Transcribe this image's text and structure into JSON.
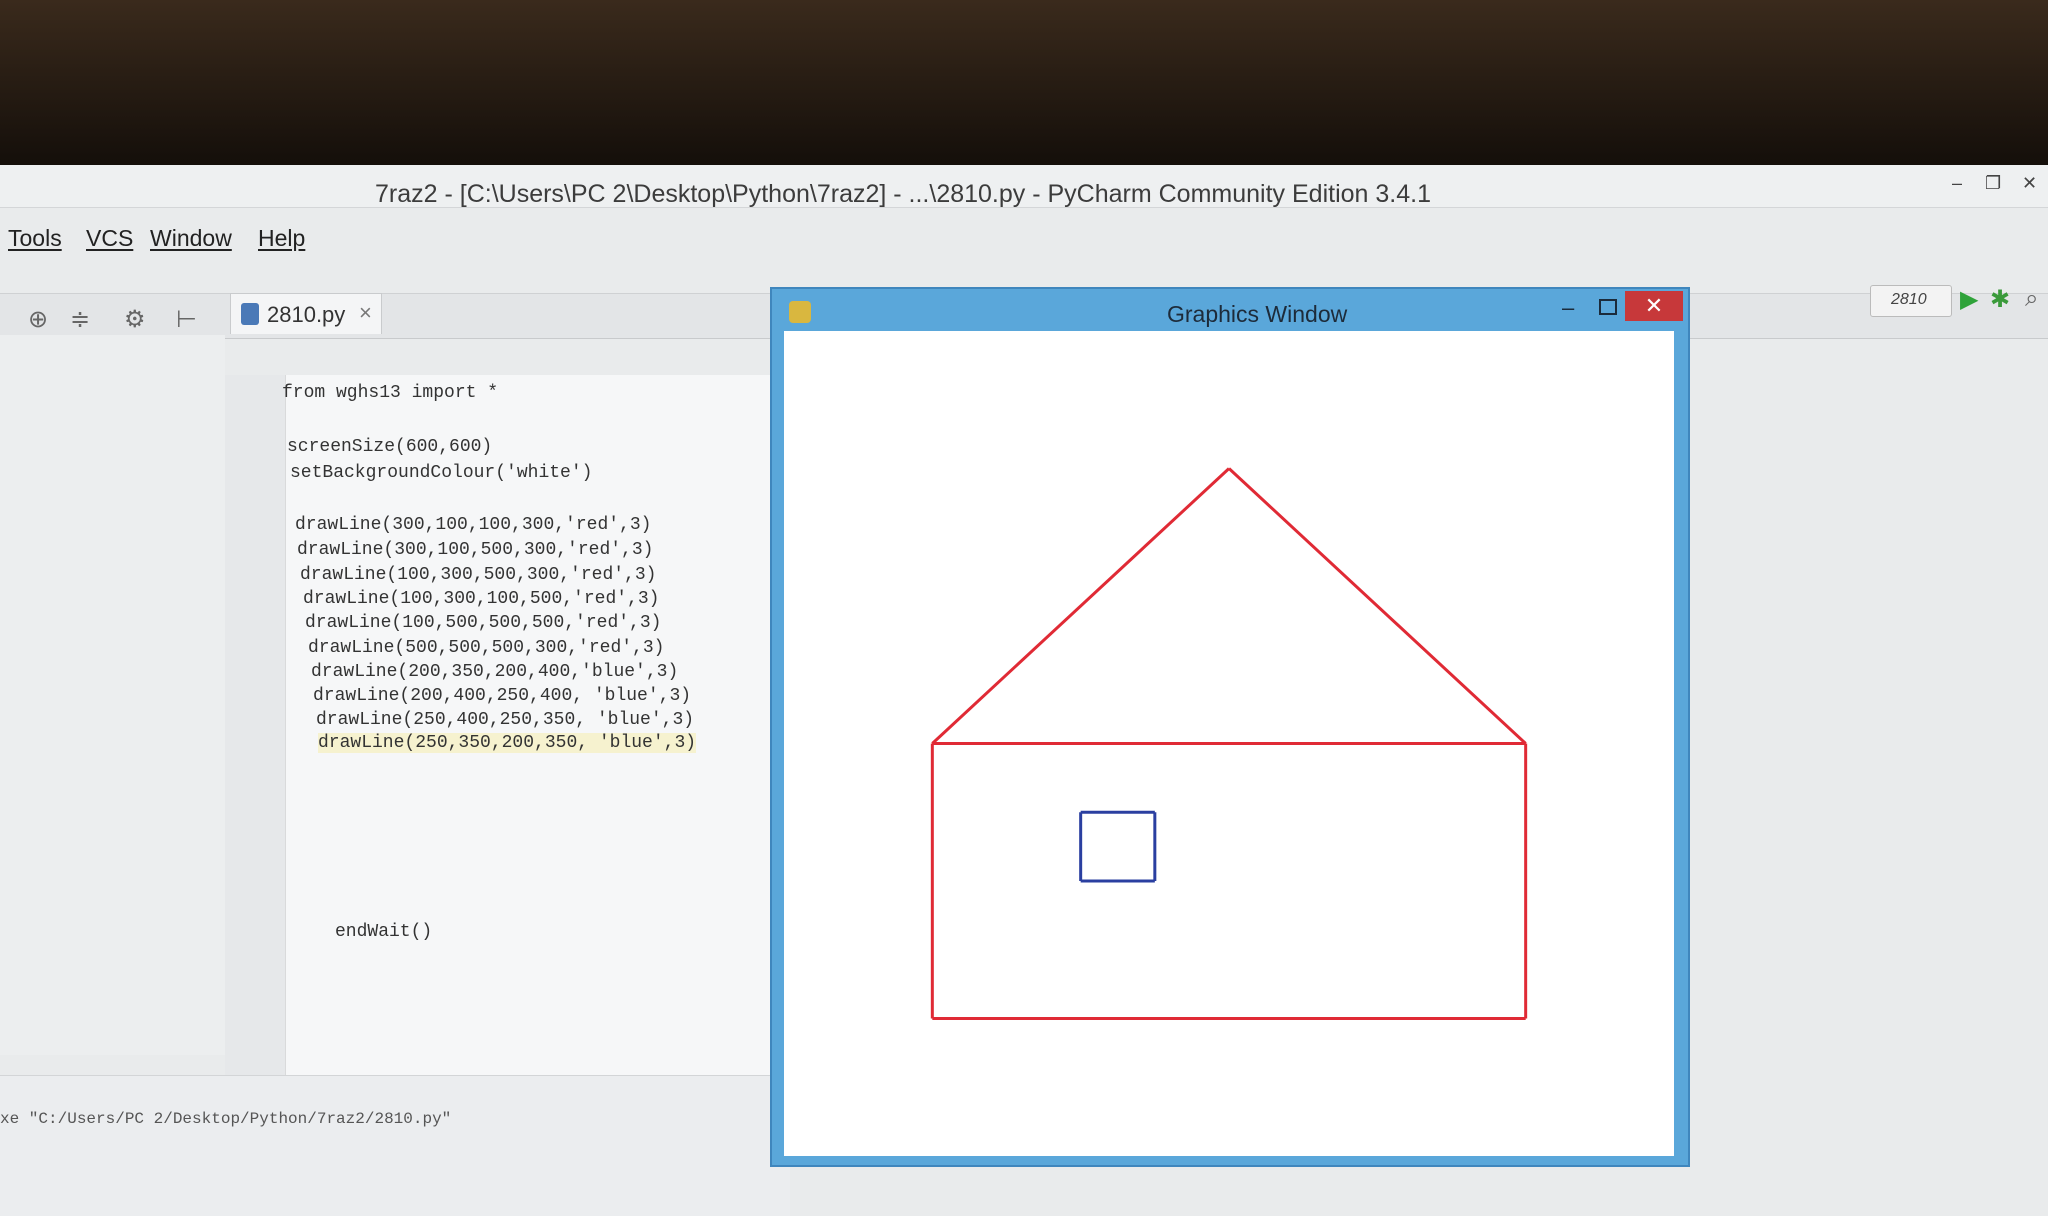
{
  "window": {
    "title": "7raz2 - [C:\\Users\\PC 2\\Desktop\\Python\\7raz2] - ...\\2810.py - PyCharm Community Edition 3.4.1",
    "minimize": "–",
    "maximize": "❐",
    "close": "✕"
  },
  "menu": [
    "Tools",
    "VCS",
    "Window",
    "Help"
  ],
  "tab": {
    "label": "2810.py",
    "close": "×"
  },
  "run_config": {
    "label": "2810"
  },
  "code": [
    "from wghs13 import *",
    "",
    "screenSize(600,600)",
    "setBackgroundColour('white')",
    "",
    "drawLine(300,100,100,300,'red',3)",
    "drawLine(300,100,500,300,'red',3)",
    "drawLine(100,300,500,300,'red',3)",
    "drawLine(100,300,100,500,'red',3)",
    "drawLine(100,500,500,500,'red',3)",
    "drawLine(500,500,500,300,'red',3)",
    "drawLine(200,350,200,400,'blue',3)",
    "drawLine(200,400,250,400, 'blue',3)",
    "drawLine(250,400,250,350, 'blue',3)",
    "drawLine(250,350,200,350, 'blue',3)",
    "endWait()"
  ],
  "console": {
    "text": "xe \"C:/Users/PC 2/Desktop/Python/7raz2/2810.py\""
  },
  "graphics_window": {
    "title": "Graphics Window",
    "close": "✕",
    "minimize": "–",
    "colors": {
      "red": "#e02a35",
      "blue": "#2a3fa0",
      "frame": "#5aa7da"
    },
    "lines": [
      [
        300,
        100,
        100,
        300,
        "red"
      ],
      [
        300,
        100,
        500,
        300,
        "red"
      ],
      [
        100,
        300,
        500,
        300,
        "red"
      ],
      [
        100,
        300,
        100,
        500,
        "red"
      ],
      [
        100,
        500,
        500,
        500,
        "red"
      ],
      [
        500,
        500,
        500,
        300,
        "red"
      ],
      [
        200,
        350,
        200,
        400,
        "blue"
      ],
      [
        200,
        400,
        250,
        400,
        "blue"
      ],
      [
        250,
        400,
        250,
        350,
        "blue"
      ],
      [
        250,
        350,
        200,
        350,
        "blue"
      ]
    ]
  }
}
